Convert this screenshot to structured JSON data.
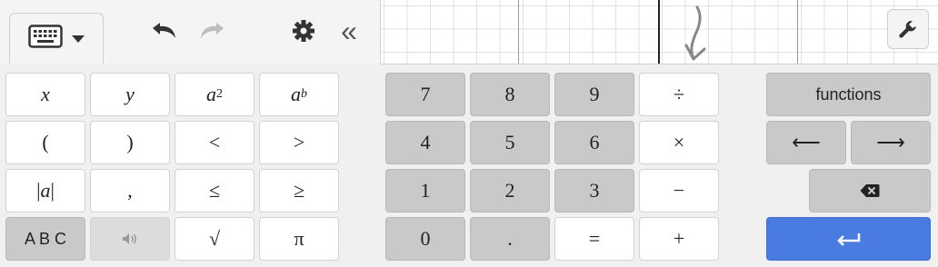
{
  "toolbar": {
    "keyboard_icon": "keyboard-icon",
    "undo_icon": "undo-icon",
    "redo_icon": "redo-icon",
    "settings_icon": "gear-icon",
    "collapse_label": "«",
    "wrench_icon": "wrench-icon"
  },
  "keys": {
    "x": "x",
    "y": "y",
    "a": "a",
    "sq": "2",
    "b": "b",
    "lparen": "(",
    "rparen": ")",
    "lt": "<",
    "gt": ">",
    "abs_a": "a",
    "comma": ",",
    "le": "≤",
    "ge": "≥",
    "abc": "A B C",
    "sqrt": "√",
    "pi": "π",
    "n7": "7",
    "n8": "8",
    "n9": "9",
    "div": "÷",
    "n4": "4",
    "n5": "5",
    "n6": "6",
    "mul": "×",
    "n1": "1",
    "n2": "2",
    "n3": "3",
    "minus": "−",
    "n0": "0",
    "dot": ".",
    "eq": "=",
    "plus": "+",
    "functions": "functions",
    "left": "⟵",
    "right": "⟶"
  },
  "colors": {
    "enter": "#4a7be0",
    "grid": "#e2e2e2"
  }
}
